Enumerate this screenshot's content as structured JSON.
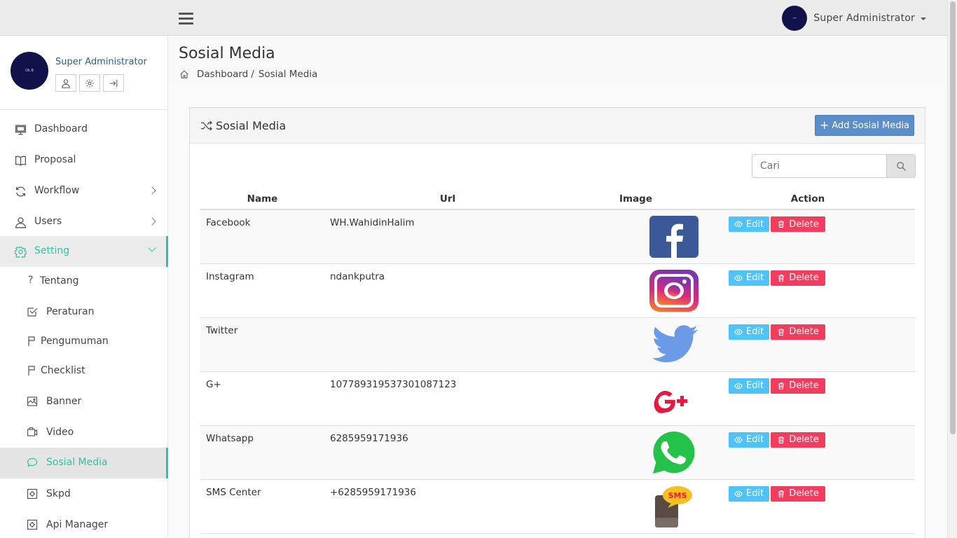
{
  "header": {
    "user_name": "Super Administrator",
    "avatar_text": "--"
  },
  "sidebar": {
    "profile": {
      "name": "Super Administrator",
      "avatar_text": "Ok.B"
    },
    "items": [
      {
        "label": "Dashboard",
        "icon": "monitor-icon"
      },
      {
        "label": "Proposal",
        "icon": "book-icon"
      },
      {
        "label": "Workflow",
        "icon": "refresh-icon"
      },
      {
        "label": "Users",
        "icon": "user-icon"
      },
      {
        "label": "Setting",
        "icon": "gear-icon"
      }
    ],
    "sub_items": [
      {
        "label": "Tentang",
        "icon": "question-icon"
      },
      {
        "label": "Peraturan",
        "icon": "checkbox-icon"
      },
      {
        "label": "Pengumuman",
        "icon": "flag-icon"
      },
      {
        "label": "Checklist",
        "icon": "flag-icon"
      },
      {
        "label": "Banner",
        "icon": "image-icon"
      },
      {
        "label": "Video",
        "icon": "video-icon"
      },
      {
        "label": "Sosial Media",
        "icon": "chat-icon"
      },
      {
        "label": "Skpd",
        "icon": "settings-box-icon"
      },
      {
        "label": "Api Manager",
        "icon": "settings-box-icon"
      }
    ]
  },
  "page": {
    "title": "Sosial Media",
    "breadcrumb": {
      "home": "Dashboard",
      "sep": "/",
      "current": "Sosial Media"
    }
  },
  "panel": {
    "title": "Sosial Media",
    "add_button": "Add Sosial Media",
    "search_placeholder": "Cari"
  },
  "table": {
    "columns": [
      "Name",
      "Url",
      "Image",
      "Action"
    ],
    "edit_label": "Edit",
    "delete_label": "Delete",
    "rows": [
      {
        "name": "Facebook",
        "url": "WH.WahidinHalim",
        "image": "facebook-logo"
      },
      {
        "name": "Instagram",
        "url": "ndankputra",
        "image": "instagram-logo"
      },
      {
        "name": "Twitter",
        "url": "",
        "image": "twitter-logo"
      },
      {
        "name": "G+",
        "url": "107789319537301087123",
        "image": "googleplus-logo"
      },
      {
        "name": "Whatsapp",
        "url": "6285959171936",
        "image": "whatsapp-logo"
      },
      {
        "name": "SMS Center",
        "url": "+6285959171936",
        "image": "sms-logo"
      }
    ]
  },
  "colors": {
    "accent": "#2dc3a5",
    "primary": "#5b8fcb",
    "info": "#4fc3f7",
    "danger": "#f23d5e"
  }
}
